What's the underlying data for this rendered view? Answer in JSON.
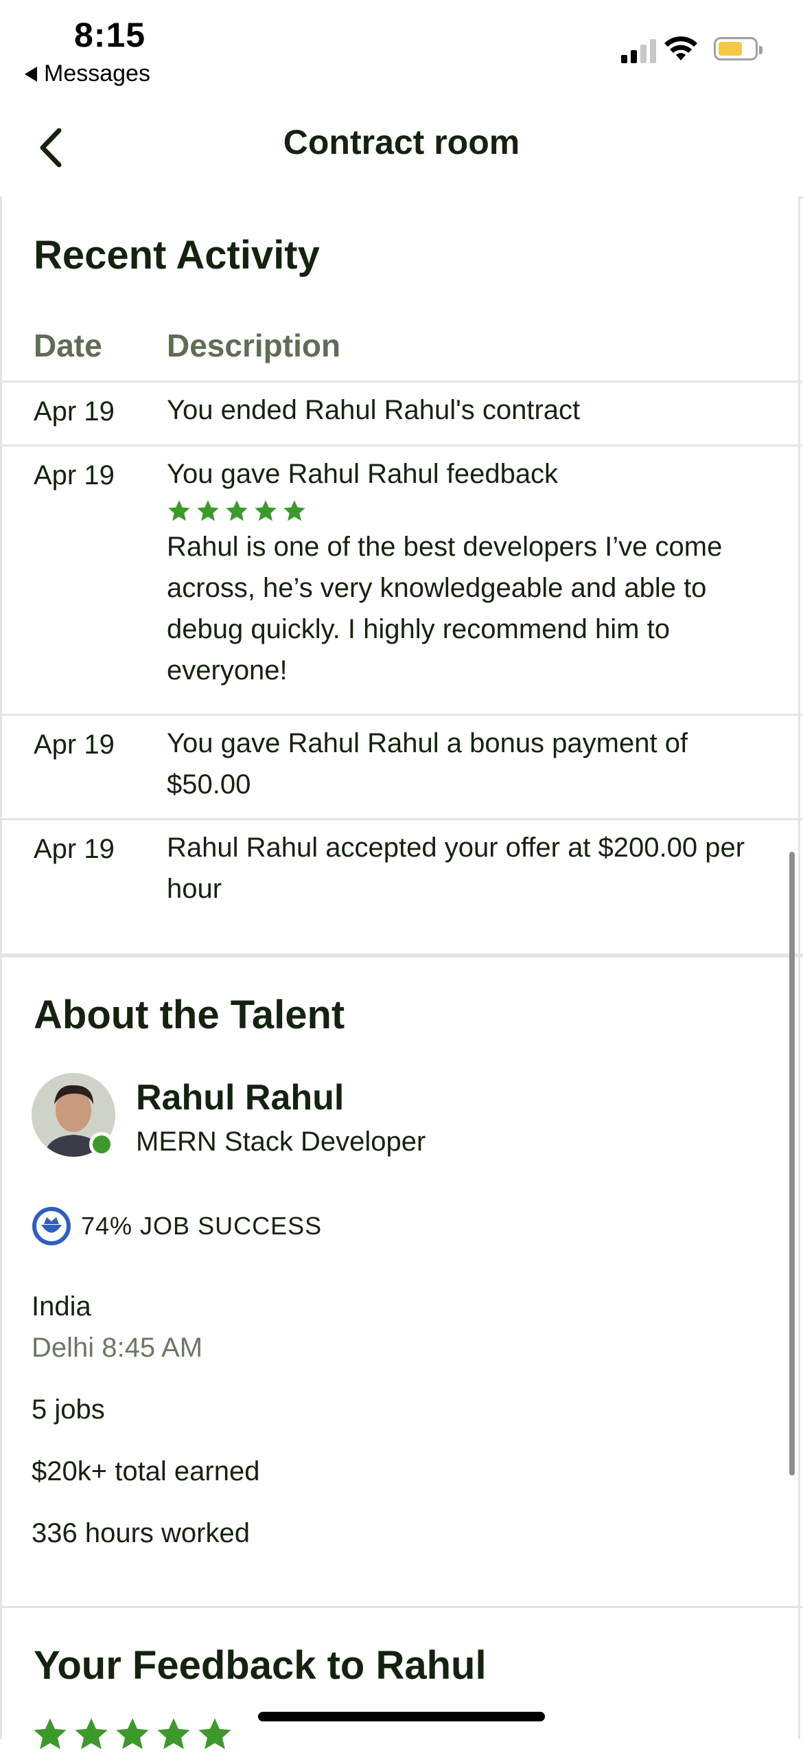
{
  "status_bar": {
    "time": "8:15",
    "back_app": "Messages"
  },
  "header": {
    "title": "Contract room"
  },
  "recent_activity": {
    "title": "Recent Activity",
    "columns": [
      "Date",
      "Description"
    ],
    "rows": [
      {
        "date": "Apr 19",
        "description": "You ended Rahul Rahul's contract"
      },
      {
        "date": "Apr 19",
        "description": "You gave Rahul Rahul feedback",
        "rating": 5,
        "comment": "Rahul is one of the best developers I’ve come across, he’s very knowledgeable and able to debug quickly. I highly recommend him to everyone!"
      },
      {
        "date": "Apr 19",
        "description": "You gave Rahul Rahul a bonus payment of $50.00"
      },
      {
        "date": "Apr 19",
        "description": "Rahul Rahul accepted your offer at $200.00 per hour"
      }
    ]
  },
  "about_talent": {
    "title": "About the Talent",
    "name": "Rahul Rahul",
    "role": "MERN Stack Developer",
    "job_success": "74% JOB SUCCESS",
    "country": "India",
    "local_time": "Delhi 8:45 AM",
    "jobs": "5 jobs",
    "earned": "$20k+ total earned",
    "hours": "336 hours worked"
  },
  "feedback": {
    "title": "Your Feedback to Rahul",
    "rating": 5
  },
  "colors": {
    "accent_green": "#3c9a2b",
    "text_dark": "#14230f",
    "muted": "#5e6d55",
    "badge_blue": "#2f5fbf"
  }
}
